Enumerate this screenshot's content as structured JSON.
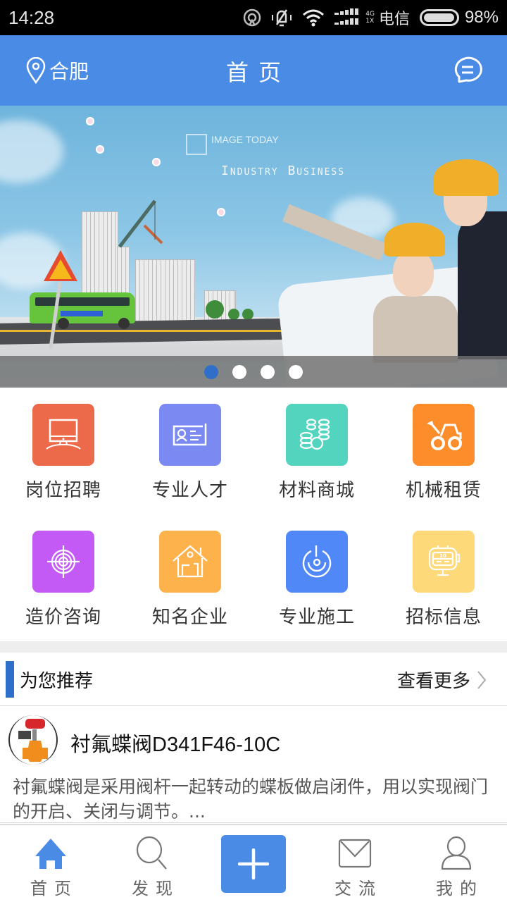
{
  "status_bar": {
    "time": "14:28",
    "net_top": "4G",
    "net_bottom": "1X",
    "carrier": "电信",
    "battery_percent": "98%",
    "battery_level": 0.98,
    "icons": [
      "hotspot-icon",
      "mute-icon",
      "wifi-icon",
      "signal-icon",
      "battery-icon"
    ]
  },
  "header": {
    "location": "合肥",
    "title": "首页",
    "location_icon": "map-pin-icon",
    "message_icon": "chat-bubble-icon"
  },
  "banner": {
    "logo_text": "IMAGE TODAY",
    "slogan": "Industry Business",
    "slide_count": 4,
    "active_slide": 1
  },
  "categories": [
    {
      "label": "岗位招聘",
      "icon": "monitor-icon",
      "color": "#ec694a"
    },
    {
      "label": "专业人才",
      "icon": "id-card-icon",
      "color": "#7a8af2"
    },
    {
      "label": "材料商城",
      "icon": "coins-icon",
      "color": "#52d4be"
    },
    {
      "label": "机械租赁",
      "icon": "loader-truck-icon",
      "color": "#fd8d2a"
    },
    {
      "label": "造价咨询",
      "icon": "target-icon",
      "color": "#c45af5"
    },
    {
      "label": "知名企业",
      "icon": "house-icon",
      "color": "#fdb24b"
    },
    {
      "label": "专业施工",
      "icon": "power-dial-icon",
      "color": "#5088f8"
    },
    {
      "label": "招标信息",
      "icon": "counter-monitor-icon",
      "color": "#fed97a"
    }
  ],
  "recommend": {
    "title": "为您推荐",
    "more": "查看更多",
    "accent": "#2f6fca",
    "items": [
      {
        "name": "衬氟蝶阀D341F46-10C",
        "description": "衬氟蝶阀是采用阀杆一起转动的蝶板做启闭件，用以实现阀门的开启、关闭与调节。..."
      }
    ]
  },
  "bottom_nav": {
    "items": [
      {
        "label": "首页",
        "icon": "home-icon",
        "active": true
      },
      {
        "label": "发现",
        "icon": "search-icon",
        "active": false
      },
      {
        "label": "",
        "icon": "plus-icon",
        "active": false
      },
      {
        "label": "交流",
        "icon": "mail-icon",
        "active": false
      },
      {
        "label": "我的",
        "icon": "user-icon",
        "active": false
      }
    ],
    "accent": "#4a8be5"
  }
}
